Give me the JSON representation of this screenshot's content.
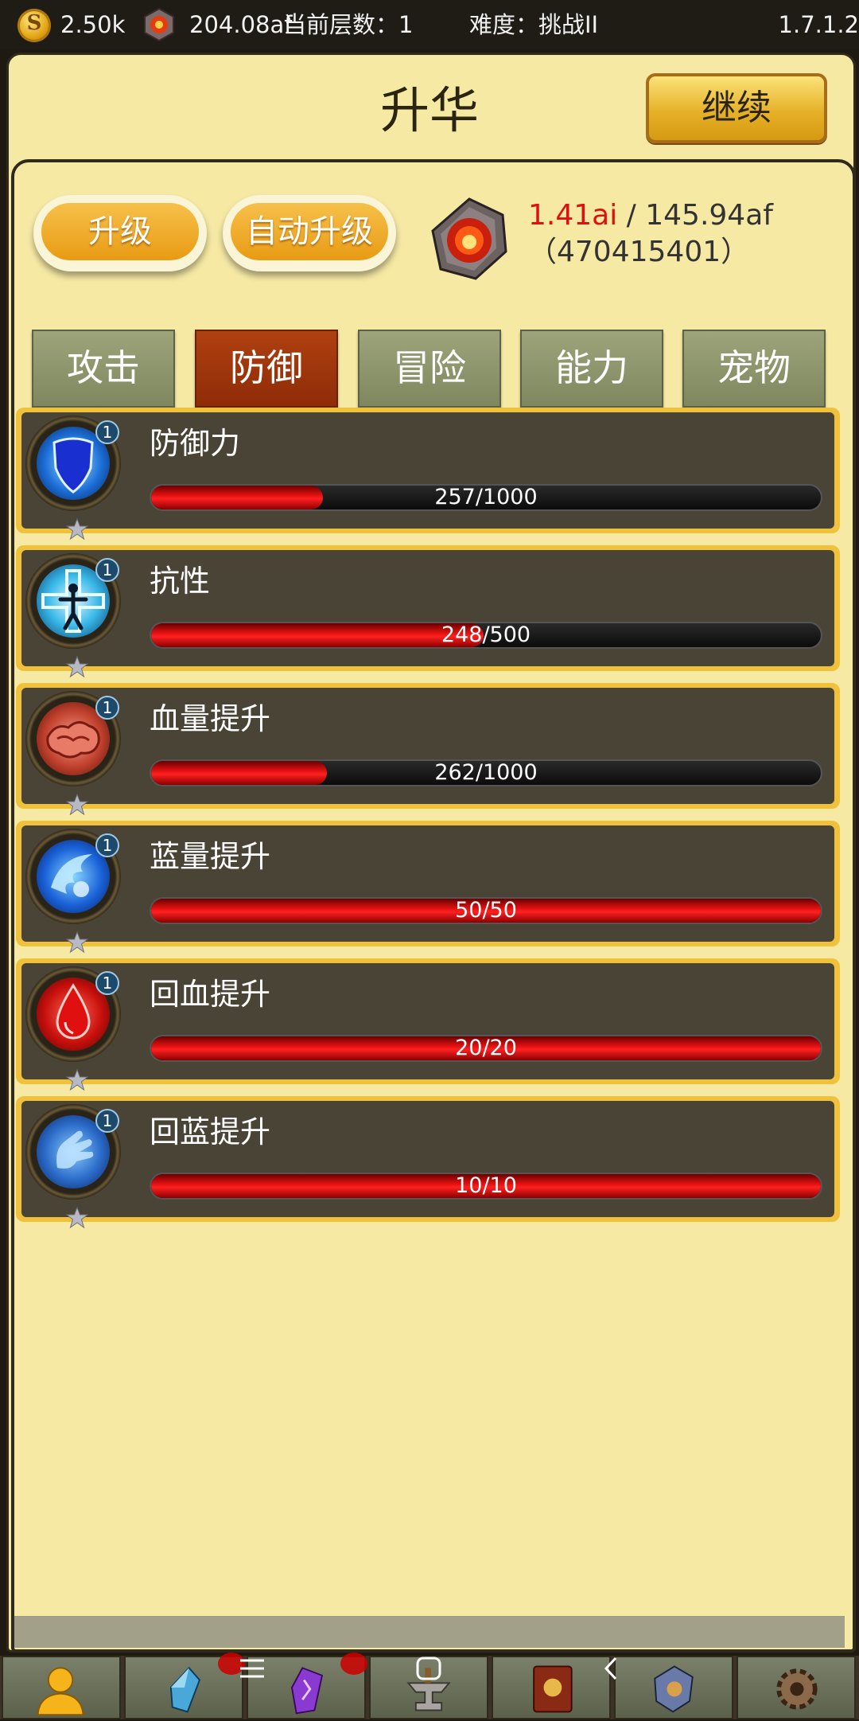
{
  "topbar": {
    "gold": "2.50k",
    "essence": "204.08af",
    "floor": "当前层数：1",
    "difficulty": "难度：挑战II",
    "version": "1.7.1.2"
  },
  "header": {
    "title": "升华",
    "continue_label": "继续"
  },
  "actions": {
    "upgrade_label": "升级",
    "auto_upgrade_label": "自动升级"
  },
  "stat": {
    "current": "1.41ai",
    "separator": " / ",
    "required": "145.94af（470415401）"
  },
  "tabs": [
    {
      "label": "攻击",
      "active": false
    },
    {
      "label": "防御",
      "active": true
    },
    {
      "label": "冒险",
      "active": false
    },
    {
      "label": "能力",
      "active": false
    },
    {
      "label": "宠物",
      "active": false
    }
  ],
  "items": [
    {
      "name": "防御力",
      "progress_text": "257/1000",
      "progress": 0.257,
      "level": "1",
      "icon": "shield-icon"
    },
    {
      "name": "抗性",
      "progress_text": "248/500",
      "progress": 0.496,
      "level": "1",
      "icon": "cross-figure-icon"
    },
    {
      "name": "血量提升",
      "progress_text": "262/1000",
      "progress": 0.262,
      "level": "1",
      "icon": "flesh-icon"
    },
    {
      "name": "蓝量提升",
      "progress_text": "50/50",
      "progress": 1.0,
      "level": "1",
      "icon": "blue-wing-icon"
    },
    {
      "name": "回血提升",
      "progress_text": "20/20",
      "progress": 1.0,
      "level": "1",
      "icon": "blood-drop-icon"
    },
    {
      "name": "回蓝提升",
      "progress_text": "10/10",
      "progress": 1.0,
      "level": "1",
      "icon": "blue-hand-icon"
    }
  ],
  "bottom_nav": [
    {
      "icon": "hero-icon"
    },
    {
      "icon": "crystal-icon"
    },
    {
      "icon": "purple-rune-icon"
    },
    {
      "icon": "anvil-icon"
    },
    {
      "icon": "book-icon"
    },
    {
      "icon": "relic-icon"
    },
    {
      "icon": "gear-icon"
    }
  ],
  "colors": {
    "panel": "#f6e9a4",
    "accent_orange": "#e89b14",
    "active_tab": "#8e2c08",
    "bar_fill": "#e01010",
    "stat_red": "#e01010"
  }
}
